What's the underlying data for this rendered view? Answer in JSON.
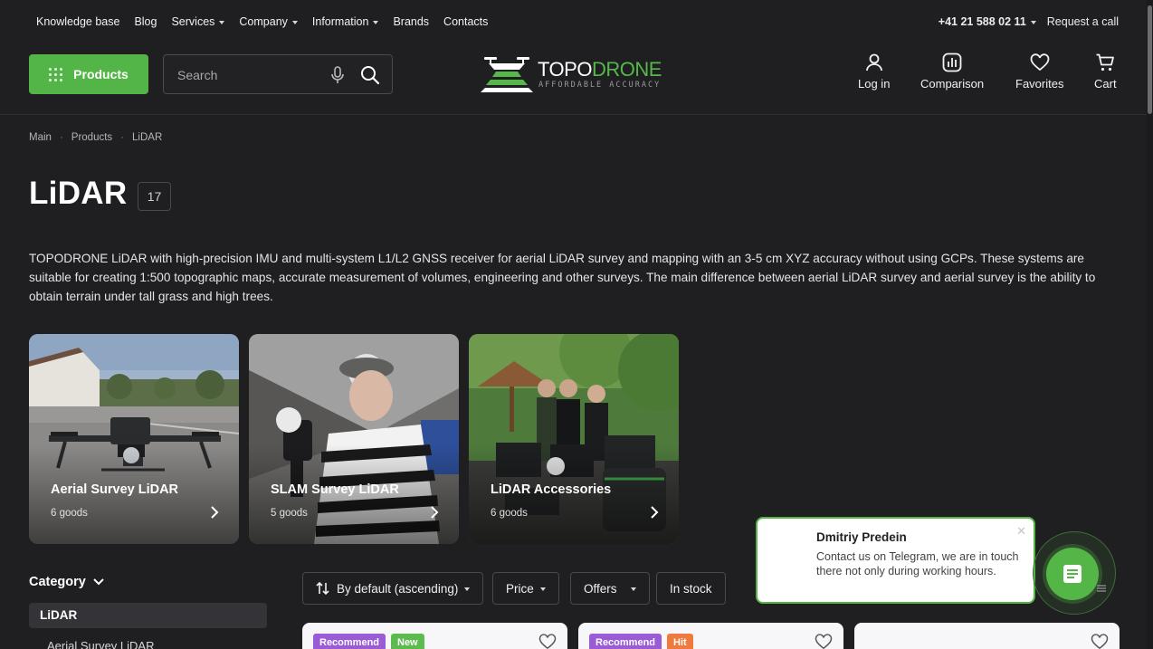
{
  "topnav": {
    "items": [
      {
        "label": "Knowledge base",
        "dropdown": false
      },
      {
        "label": "Blog",
        "dropdown": false
      },
      {
        "label": "Services",
        "dropdown": true
      },
      {
        "label": "Company",
        "dropdown": true
      },
      {
        "label": "Information",
        "dropdown": true
      },
      {
        "label": "Brands",
        "dropdown": false
      },
      {
        "label": "Contacts",
        "dropdown": false
      }
    ],
    "phone": "+41 21 588 02 11",
    "request_call": "Request a call"
  },
  "header": {
    "products_label": "Products",
    "search_placeholder": "Search",
    "logo_text_a": "TOPO",
    "logo_text_b": "DRONE",
    "logo_tagline": "AFFORDABLE ACCURACY",
    "actions": [
      {
        "label": "Log in",
        "icon": "user-icon"
      },
      {
        "label": "Comparison",
        "icon": "comparison-icon"
      },
      {
        "label": "Favorites",
        "icon": "heart-icon"
      },
      {
        "label": "Cart",
        "icon": "cart-icon"
      }
    ]
  },
  "breadcrumb": [
    "Main",
    "Products",
    "LiDAR"
  ],
  "page": {
    "title": "LiDAR",
    "count": "17",
    "description": "TOPODRONE LiDAR with high-precision IMU and multi-system L1/L2 GNSS receiver for aerial LiDAR survey and mapping with an 3-5 cm XYZ accuracy without using GCPs. These systems are suitable for creating 1:500 topographic maps, accurate measurement of volumes, engineering and other surveys. The main difference between aerial LiDAR survey and aerial survey is the ability to obtain terrain under tall grass and high trees."
  },
  "categories": [
    {
      "title": "Aerial Survey LiDAR",
      "goods": "6 goods"
    },
    {
      "title": "SLAM Survey LiDAR",
      "goods": "5 goods"
    },
    {
      "title": "LiDAR Accessories",
      "goods": "6 goods"
    }
  ],
  "sidebar": {
    "heading": "Category",
    "active": "LiDAR",
    "sub_item": "Aerial Survey LiDAR"
  },
  "filters": {
    "sort": "By default (ascending)",
    "price": "Price",
    "offers": "Offers",
    "in_stock": "In stock"
  },
  "products": [
    {
      "badges": [
        {
          "label": "Recommend",
          "color": "#9a5bd6"
        },
        {
          "label": "New",
          "color": "#5cbb4e"
        }
      ]
    },
    {
      "badges": [
        {
          "label": "Recommend",
          "color": "#9a5bd6"
        },
        {
          "label": "Hit",
          "color": "#ef7a3d"
        }
      ]
    },
    {
      "badges": []
    }
  ],
  "chat": {
    "name": "Dmitriy Predein",
    "message": "Contact us on Telegram, we are in touch there not only during working hours."
  },
  "colors": {
    "background": "#1f1f22",
    "accent": "#53b548"
  }
}
